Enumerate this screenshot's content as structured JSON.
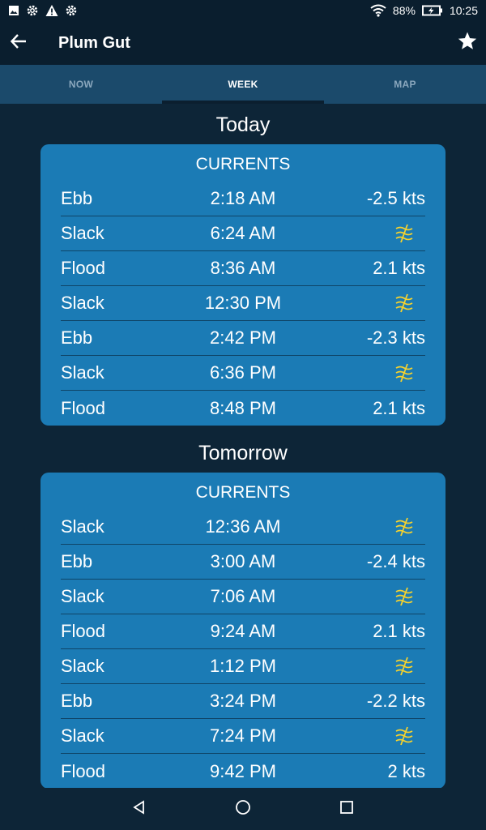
{
  "status": {
    "battery": "88%",
    "time": "10:25"
  },
  "appbar": {
    "title": "Plum Gut"
  },
  "tabs": [
    {
      "label": "NOW"
    },
    {
      "label": "WEEK"
    },
    {
      "label": "MAP"
    }
  ],
  "days": [
    {
      "heading": "Today",
      "card_title": "CURRENTS",
      "rows": [
        {
          "type": "Ebb",
          "time": "2:18 AM",
          "value": "-2.5 kts"
        },
        {
          "type": "Slack",
          "time": "6:24 AM",
          "value": ""
        },
        {
          "type": "Flood",
          "time": "8:36 AM",
          "value": "2.1 kts"
        },
        {
          "type": "Slack",
          "time": "12:30 PM",
          "value": ""
        },
        {
          "type": "Ebb",
          "time": "2:42 PM",
          "value": "-2.3 kts"
        },
        {
          "type": "Slack",
          "time": "6:36 PM",
          "value": ""
        },
        {
          "type": "Flood",
          "time": "8:48 PM",
          "value": "2.1 kts"
        }
      ]
    },
    {
      "heading": "Tomorrow",
      "card_title": "CURRENTS",
      "rows": [
        {
          "type": "Slack",
          "time": "12:36 AM",
          "value": ""
        },
        {
          "type": "Ebb",
          "time": "3:00 AM",
          "value": "-2.4 kts"
        },
        {
          "type": "Slack",
          "time": "7:06 AM",
          "value": ""
        },
        {
          "type": "Flood",
          "time": "9:24 AM",
          "value": "2.1 kts"
        },
        {
          "type": "Slack",
          "time": "1:12 PM",
          "value": ""
        },
        {
          "type": "Ebb",
          "time": "3:24 PM",
          "value": "-2.2 kts"
        },
        {
          "type": "Slack",
          "time": "7:24 PM",
          "value": ""
        },
        {
          "type": "Flood",
          "time": "9:42 PM",
          "value": "2 kts"
        }
      ]
    }
  ],
  "colors": {
    "background": "#0d2537",
    "card": "#1b7bb5",
    "tab_bar": "#1b4a6b",
    "slack_icon": "#f5d22e"
  },
  "icons": {
    "slack": "slack-current-icon"
  }
}
